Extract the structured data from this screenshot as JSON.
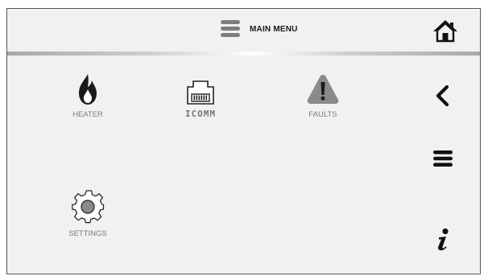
{
  "header": {
    "title": "MAIN MENU",
    "menu_icon": "menu-icon",
    "home_icon": "home-icon"
  },
  "tiles": [
    {
      "label": "HEATER",
      "icon": "flame-icon"
    },
    {
      "label": "ICOMM",
      "icon": "network-port-icon"
    },
    {
      "label": "FAULTS",
      "icon": "warning-icon"
    },
    {
      "label": "SETTINGS",
      "icon": "gear-icon"
    }
  ],
  "sidebar": {
    "back_icon": "chevron-left-icon",
    "menu_icon": "hamburger-icon",
    "info_icon": "info-icon"
  },
  "colors": {
    "background": "#f1f1f1",
    "icon_dark": "#1a1a1a",
    "icon_gray": "#8a8a8a",
    "label_gray": "#7a7a7a"
  }
}
